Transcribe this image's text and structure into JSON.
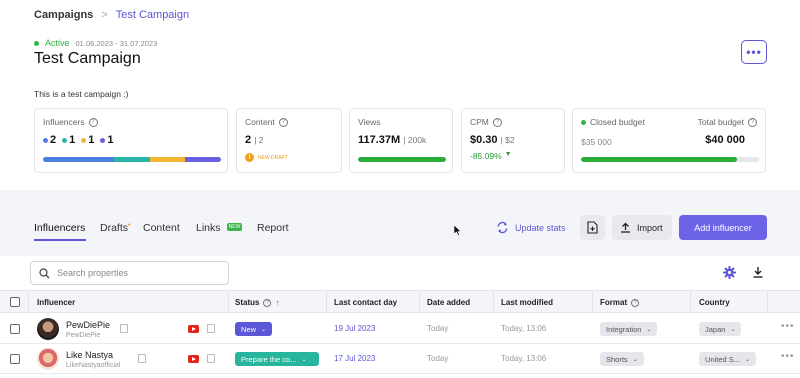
{
  "breadcrumb": {
    "parent": "Campaigns",
    "separator": ">",
    "current": "Test Campaign"
  },
  "campaign": {
    "status": "Active",
    "dates": "01.06.2023 - 31.07.2023",
    "title": "Test Campaign",
    "description": "This is a test campaign :)",
    "more": "•••"
  },
  "stats": {
    "influencers": {
      "label": "Influencers",
      "counts": [
        "2",
        "1",
        "1",
        "1"
      ],
      "colors": [
        "#4a7fe0",
        "#2bb5a8",
        "#f2b632",
        "#6a5fe0"
      ]
    },
    "content": {
      "label": "Content",
      "value": "2",
      "sub": "| 2",
      "badge": "NEW DRAFT"
    },
    "views": {
      "label": "Views",
      "value": "117.37M",
      "sub": "| 200k",
      "progress": 1.0
    },
    "cpm": {
      "label": "CPM",
      "value": "$0.30",
      "sub": "| $2",
      "change": "-85.09%",
      "change_icon": "▼"
    },
    "budget": {
      "closed_label": "Closed budget",
      "closed_value": "$35 000",
      "total_label": "Total budget",
      "total_value": "$40 000",
      "progress": 0.875
    },
    "accent_green": "#2bad3a"
  },
  "tabs": [
    {
      "label": "Influencers"
    },
    {
      "label": "Drafts"
    },
    {
      "label": "Content"
    },
    {
      "label": "Links"
    },
    {
      "label": "Report"
    }
  ],
  "links_badge": "NEW",
  "draft_indicator": "•",
  "actions": {
    "update_stats": "Update stats",
    "import": "Import",
    "add_influencer": "Add influencer"
  },
  "search": {
    "placeholder": "Search properties"
  },
  "table": {
    "columns": {
      "influencer": "Influencer",
      "status": "Status",
      "last_contact": "Last contact day",
      "date_added": "Date added",
      "last_modified": "Last modified",
      "format": "Format",
      "country": "Country"
    },
    "sort_arrow": "↑",
    "rows": [
      {
        "name": "PewDiePie",
        "handle": "PewDiePie",
        "status": "New",
        "status_color": "#5b57d6",
        "last_contact": "19 Jul 2023",
        "date_added": "Today",
        "last_modified": "Today, 13:06",
        "format": "Integration",
        "country": "Japan"
      },
      {
        "name": "Like Nastya",
        "handle": "LikeNastyaofficial",
        "status": "Prepare the co...",
        "status_color": "#27b59d",
        "last_contact": "17 Jul 2023",
        "date_added": "Today",
        "last_modified": "Today, 13:06",
        "format": "Shorts",
        "country": "United S..."
      }
    ]
  },
  "icons": [
    "chevron-right-icon",
    "question-icon",
    "warning-icon",
    "sync-icon",
    "file-plus-icon",
    "upload-icon",
    "search-icon",
    "gear-icon",
    "download-icon",
    "youtube-icon",
    "copy-icon",
    "chevron-down-icon",
    "more-icon"
  ]
}
